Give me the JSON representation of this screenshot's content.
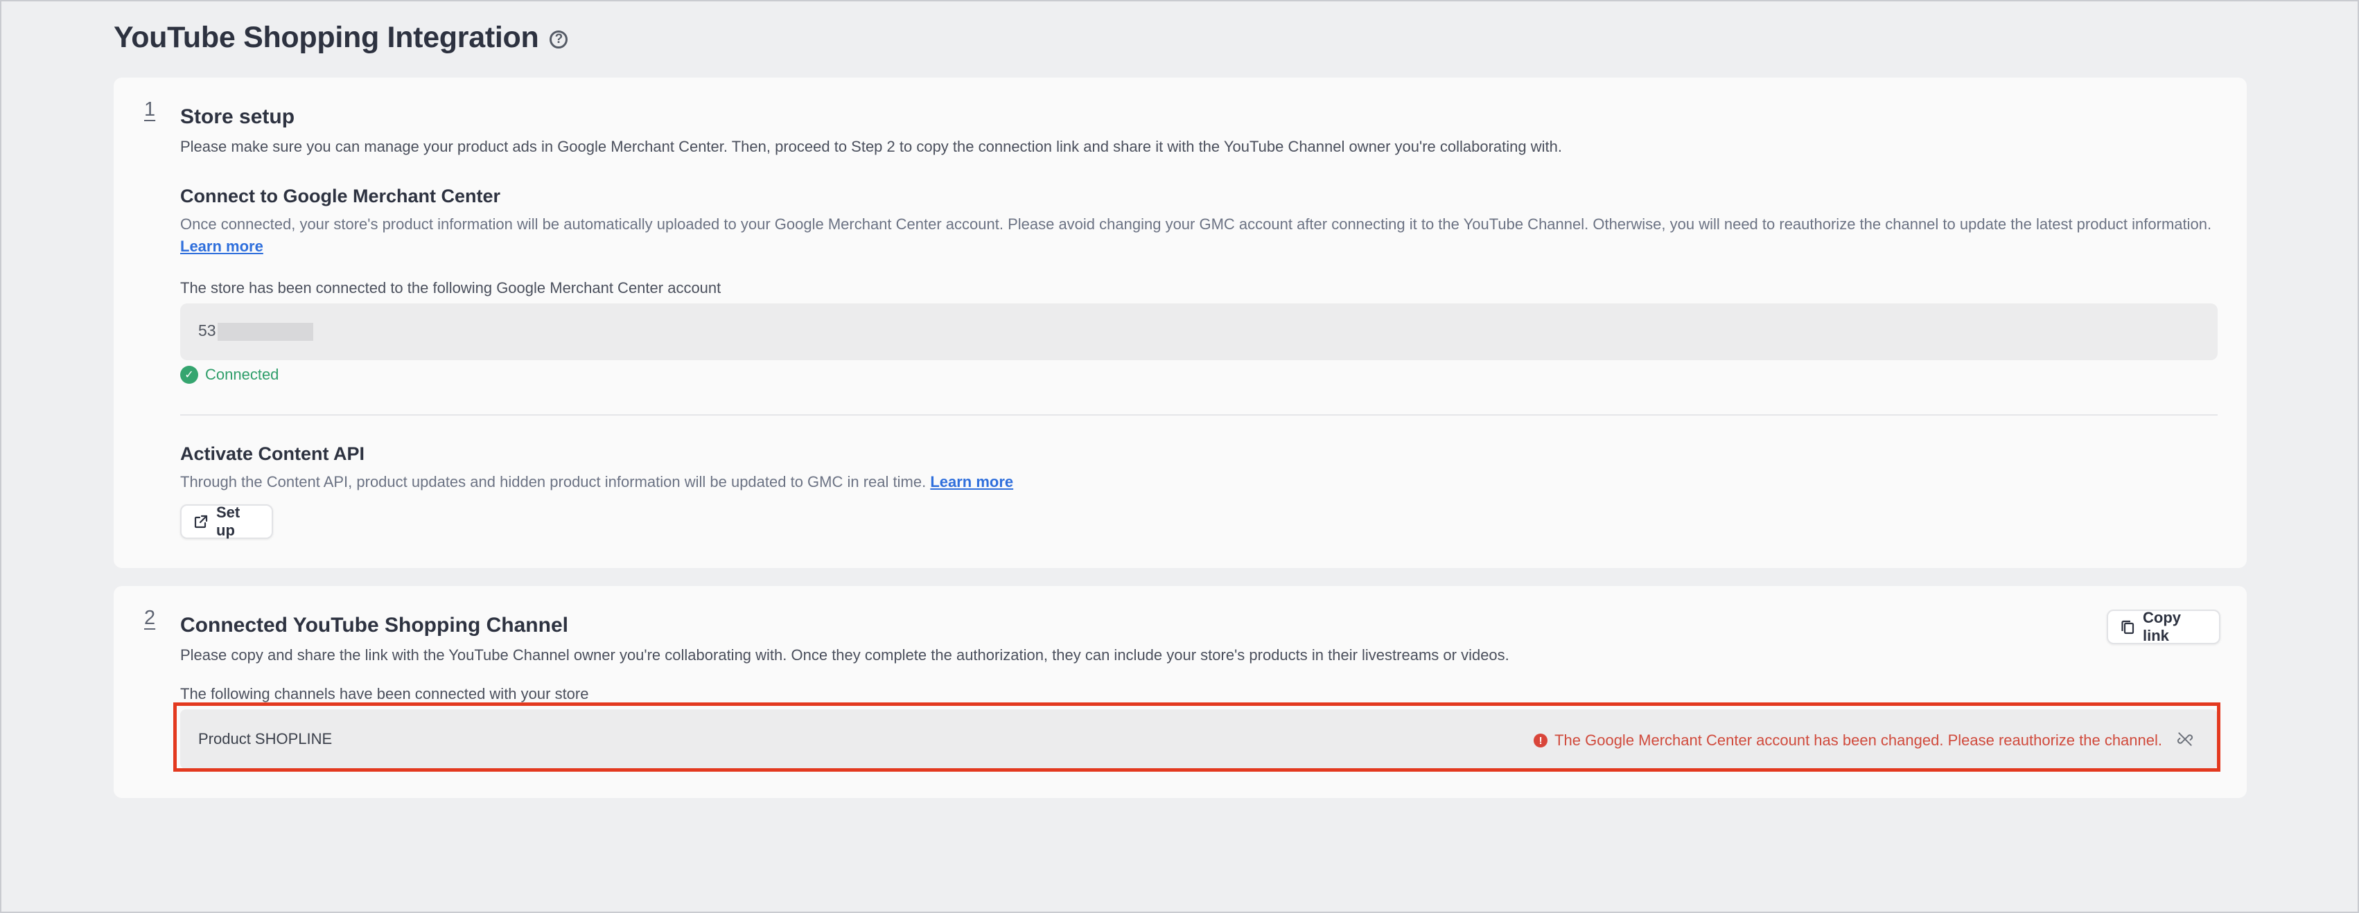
{
  "page": {
    "title": "YouTube Shopping Integration"
  },
  "step1": {
    "number": "1",
    "title": "Store setup",
    "description": "Please make sure you can manage your product ads in Google Merchant Center. Then, proceed to Step 2 to copy the connection link and share it with the YouTube Channel owner you're collaborating with.",
    "gmc": {
      "title": "Connect to Google Merchant Center",
      "description": "Once connected, your store's product information will be automatically uploaded to your Google Merchant Center account. Please avoid changing your GMC account after connecting it to the YouTube Channel. Otherwise, you will need to reauthorize the channel to update the latest product information.",
      "learn_more": "Learn more",
      "connected_label": "The store has been connected to the following Google Merchant Center account",
      "account_prefix": "53",
      "status": "Connected"
    },
    "api": {
      "title": "Activate Content API",
      "description": "Through the Content API, product updates and hidden product information will be updated to GMC in real time.",
      "learn_more": "Learn more",
      "setup_label": "Set up"
    }
  },
  "step2": {
    "number": "2",
    "title": "Connected YouTube Shopping Channel",
    "description": "Please copy and share the link with the YouTube Channel owner you're collaborating with. Once they complete the authorization, they can include your store's products in their livestreams or videos.",
    "copy_label": "Copy link",
    "channels_label": "The following channels have been connected with your store",
    "channels": [
      {
        "name": "Product SHOPLINE",
        "error": "The Google Merchant Center account has been changed. Please reauthorize the channel."
      }
    ]
  },
  "colors": {
    "accent_link": "#2f6fdc",
    "success": "#35a56f",
    "error": "#d04a3c",
    "highlight_border": "#e3391f"
  }
}
